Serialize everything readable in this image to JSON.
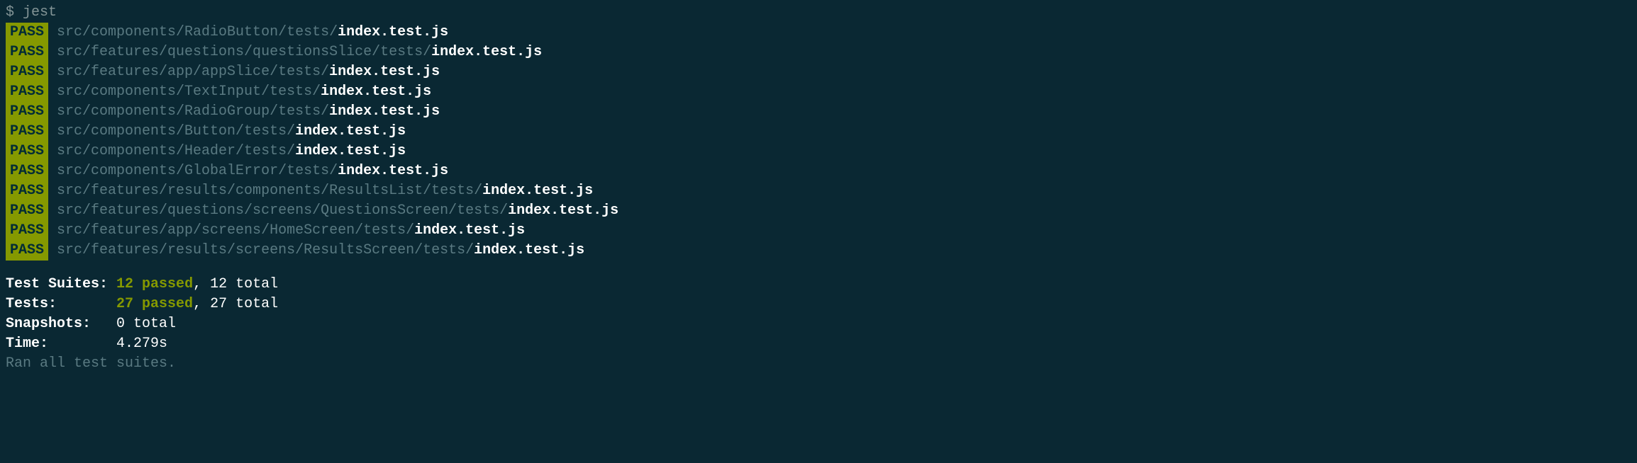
{
  "prompt": {
    "symbol": "$",
    "command": "jest"
  },
  "tests": [
    {
      "status": "PASS",
      "path": "src/components/RadioButton/tests/",
      "file": "index.test.js"
    },
    {
      "status": "PASS",
      "path": "src/features/questions/questionsSlice/tests/",
      "file": "index.test.js"
    },
    {
      "status": "PASS",
      "path": "src/features/app/appSlice/tests/",
      "file": "index.test.js"
    },
    {
      "status": "PASS",
      "path": "src/components/TextInput/tests/",
      "file": "index.test.js"
    },
    {
      "status": "PASS",
      "path": "src/components/RadioGroup/tests/",
      "file": "index.test.js"
    },
    {
      "status": "PASS",
      "path": "src/components/Button/tests/",
      "file": "index.test.js"
    },
    {
      "status": "PASS",
      "path": "src/components/Header/tests/",
      "file": "index.test.js"
    },
    {
      "status": "PASS",
      "path": "src/components/GlobalError/tests/",
      "file": "index.test.js"
    },
    {
      "status": "PASS",
      "path": "src/features/results/components/ResultsList/tests/",
      "file": "index.test.js"
    },
    {
      "status": "PASS",
      "path": "src/features/questions/screens/QuestionsScreen/tests/",
      "file": "index.test.js"
    },
    {
      "status": "PASS",
      "path": "src/features/app/screens/HomeScreen/tests/",
      "file": "index.test.js"
    },
    {
      "status": "PASS",
      "path": "src/features/results/screens/ResultsScreen/tests/",
      "file": "index.test.js"
    }
  ],
  "summary": {
    "testSuites": {
      "label": "Test Suites:",
      "passed": "12 passed",
      "total": "12 total"
    },
    "tests": {
      "label": "Tests:",
      "passed": "27 passed",
      "total": "27 total"
    },
    "snapshots": {
      "label": "Snapshots:",
      "value": "0 total"
    },
    "time": {
      "label": "Time:",
      "value": "4.279s"
    },
    "ranLine": "Ran all test suites."
  }
}
